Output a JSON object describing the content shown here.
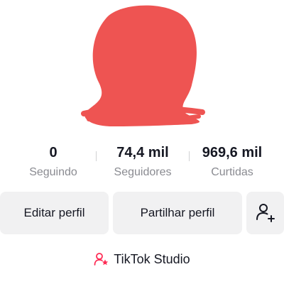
{
  "profile": {
    "avatar": "redacted-profile-photo",
    "avatar_color": "#ee5452"
  },
  "stats": [
    {
      "value": "0",
      "label": "Seguindo"
    },
    {
      "value": "74,4 mil",
      "label": "Seguidores"
    },
    {
      "value": "969,6 mil",
      "label": "Curtidas"
    }
  ],
  "actions": {
    "edit_label": "Editar perfil",
    "share_label": "Partilhar perfil",
    "add_friend_icon": "add-user-icon"
  },
  "studio": {
    "label": "TikTok Studio",
    "icon": "creator-person-star-icon",
    "accent": "#fe2c55"
  }
}
